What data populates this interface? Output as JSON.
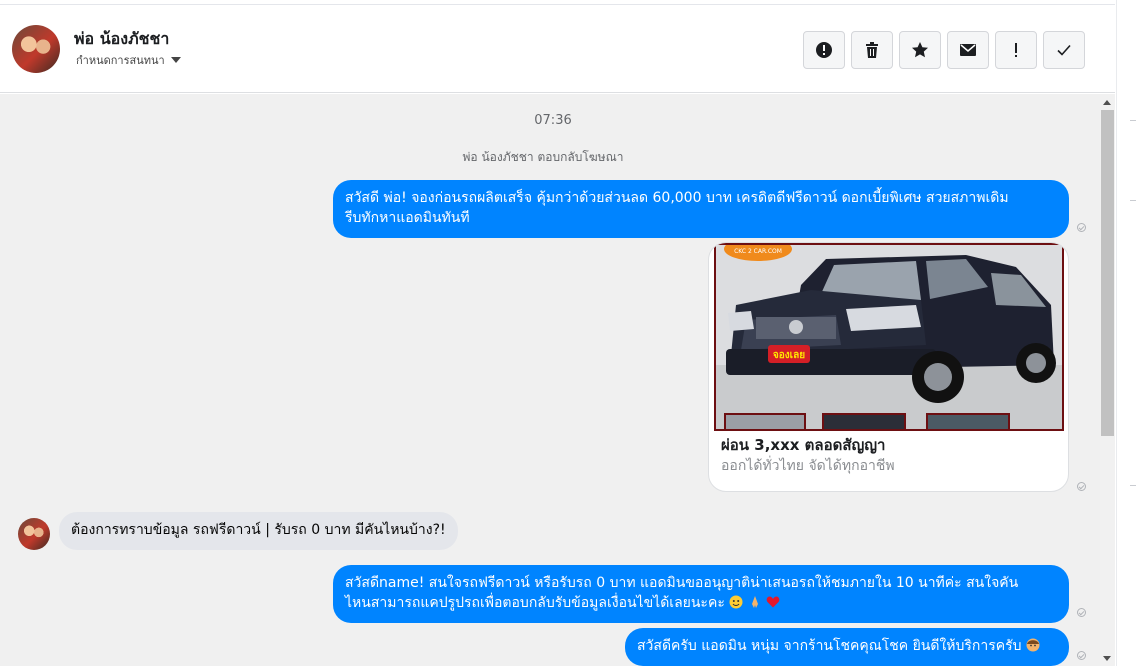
{
  "header": {
    "contact_name": "พ่อ น้องภัชชา",
    "sub_label": "กำหนดการสนทนา",
    "actions": [
      {
        "name": "report-icon",
        "label": "!"
      },
      {
        "name": "trash-icon",
        "label": "delete"
      },
      {
        "name": "star-icon",
        "label": "star"
      },
      {
        "name": "mail-icon",
        "label": "mail"
      },
      {
        "name": "exclaim-icon",
        "label": "!"
      },
      {
        "name": "check-icon",
        "label": "done"
      }
    ]
  },
  "thread": {
    "timestamp": "07:36",
    "note": "พ่อ น้องภัชชา ตอบกลับโฆษณา",
    "messages": {
      "m1_line1": "สวัสดี พ่อ! จองก่อนรถผลิตเสร็จ คุ้มกว่าด้วยส่วนลด 60,000 บาท เครดิตดีฟรีดาวน์ ดอกเบี้ยพิเศษ สวยสภาพเดิม",
      "m1_line2": "รีบทักหาแอดมินทันที",
      "ad_title": "ผ่อน 3,xxx ตลอดสัญญา",
      "ad_subtitle": "ออกได้ทั่วไทย จัดได้ทุกอาชีพ",
      "ad_logo_text": "CKC 2 CAR.COM",
      "ad_badge_text": "จองเลย",
      "m2": "ต้องการทราบข้อมูล รถฟรีดาวน์ | รับรถ 0 บาท มีคันไหนบ้าง?!",
      "m3_line1": "สวัสดีname! สนใจรถฟรีดาวน์ หรือรับรถ 0 บาท แอดมินขออนุญาติน่าเสนอรถให้ชมภายใน 10 นาทีค่ะ สนใจคัน",
      "m3_line2": "ไหนสามารถแคปรูปรถเพื่อตอบกลับรับข้อมูลเงื่อนไขได้เลยนะคะ",
      "m4": "สวัสดีครับ แอดมิน หนุ่ม จากร้านโชคคุณโชค ยินดีให้บริการครับ"
    }
  },
  "colors": {
    "outgoing": "#0084ff",
    "incoming": "#e4e6eb",
    "thread_bg": "#f0f0f0"
  }
}
